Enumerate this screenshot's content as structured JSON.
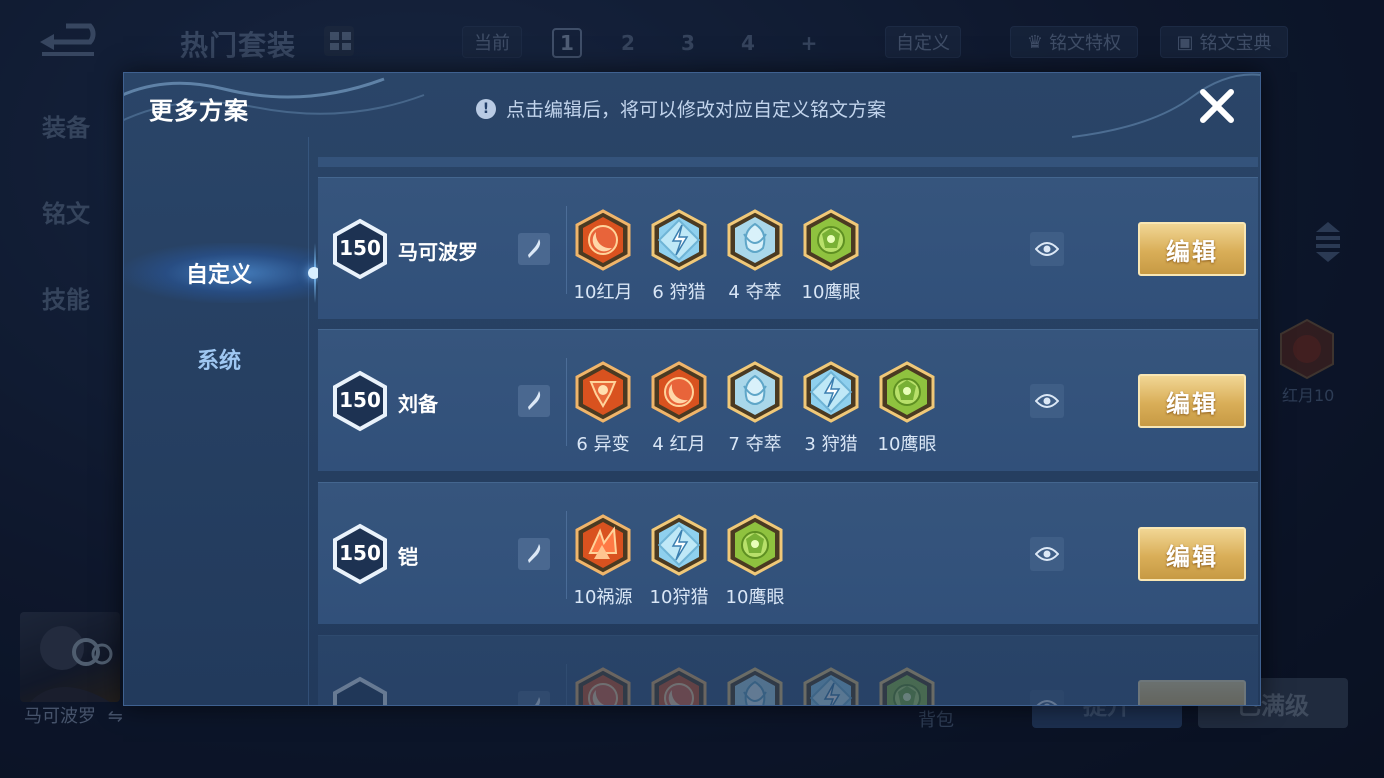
{
  "background": {
    "title": "热门套装",
    "current_label": "当前",
    "pages": [
      "1",
      "2",
      "3",
      "4",
      "+"
    ],
    "custom_label": "自定义",
    "privilege_label": "铭文特权",
    "codex_label": "铭文宝典",
    "side_items": [
      "装备",
      "铭文",
      "技能"
    ],
    "right_rune_label": "红月10",
    "hero_name": "马可波罗",
    "bag_label": "背包",
    "bottom_left_button": "提升",
    "bottom_right_button": "已满级"
  },
  "modal": {
    "title": "更多方案",
    "hint": "点击编辑后，将可以修改对应自定义铭文方案",
    "tabs": [
      {
        "label": "自定义",
        "active": true
      },
      {
        "label": "系统",
        "active": false
      }
    ],
    "edit_label": "编辑",
    "rows": [
      {
        "level": "150",
        "name": "马可波罗",
        "runes": [
          {
            "type": "red-moon",
            "label": "10红月"
          },
          {
            "type": "hunter",
            "label": "6 狩猎"
          },
          {
            "type": "plunder",
            "label": "4 夺萃"
          },
          {
            "type": "eagle-eye",
            "label": "10鹰眼"
          }
        ]
      },
      {
        "level": "150",
        "name": "刘备",
        "runes": [
          {
            "type": "mutation",
            "label": "6 异变"
          },
          {
            "type": "red-moon",
            "label": "4 红月"
          },
          {
            "type": "plunder",
            "label": "7 夺萃"
          },
          {
            "type": "hunter",
            "label": "3 狩猎"
          },
          {
            "type": "eagle-eye",
            "label": "10鹰眼"
          }
        ]
      },
      {
        "level": "150",
        "name": "铠",
        "runes": [
          {
            "type": "calamity",
            "label": "10祸源"
          },
          {
            "type": "hunter",
            "label": "10狩猎"
          },
          {
            "type": "eagle-eye",
            "label": "10鹰眼"
          }
        ]
      }
    ]
  },
  "colors": {
    "red_rune": "#d9521f",
    "blue_rune": "#8fd0ee",
    "green_rune": "#8fc23f",
    "gold_button": "#d9ae58"
  }
}
